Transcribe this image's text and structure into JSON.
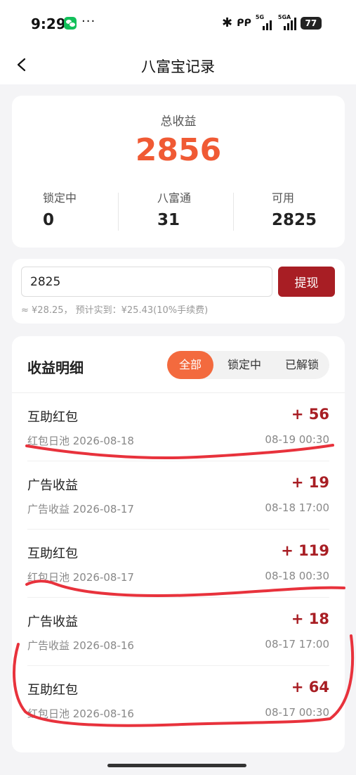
{
  "status_bar": {
    "time": "9:29",
    "more": "···",
    "network1": "5G",
    "network2": "5GA",
    "battery": "77",
    "icons": [
      "wechat-icon",
      "bluetooth-icon",
      "earbuds-icon",
      "signal-icon",
      "battery-icon"
    ]
  },
  "nav": {
    "back_icon": "chevron-left-icon",
    "title": "八富宝记录"
  },
  "summary": {
    "total_label": "总收益",
    "total_value": "2856",
    "stats": [
      {
        "label": "锁定中",
        "value": "0"
      },
      {
        "label": "八富通",
        "value": "31"
      },
      {
        "label": "可用",
        "value": "2825"
      }
    ]
  },
  "withdraw": {
    "input_value": "2825",
    "button_label": "提现",
    "note": "≈ ¥28.25， 预计实到：¥25.43(10%手续费)"
  },
  "details": {
    "title": "收益明细",
    "tabs": [
      {
        "label": "全部",
        "active": true
      },
      {
        "label": "锁定中",
        "active": false
      },
      {
        "label": "已解锁",
        "active": false
      }
    ],
    "records": [
      {
        "title": "互助红包",
        "amount": "+ 56",
        "source": "红包日池 2026-08-18",
        "time": "08-19 00:30"
      },
      {
        "title": "广告收益",
        "amount": "+ 19",
        "source": "广告收益 2026-08-17",
        "time": "08-18 17:00"
      },
      {
        "title": "互助红包",
        "amount": "+ 119",
        "source": "红包日池 2026-08-17",
        "time": "08-18 00:30"
      },
      {
        "title": "广告收益",
        "amount": "+ 18",
        "source": "广告收益 2026-08-16",
        "time": "08-17 17:00"
      },
      {
        "title": "互助红包",
        "amount": "+ 64",
        "source": "红包日池 2026-08-16",
        "time": "08-17 00:30"
      }
    ]
  },
  "colors": {
    "accent": "#f05a34",
    "tab_active": "#f36a3e",
    "button": "#a81e24",
    "amount": "#a81e24",
    "annotation": "#e8323c"
  }
}
